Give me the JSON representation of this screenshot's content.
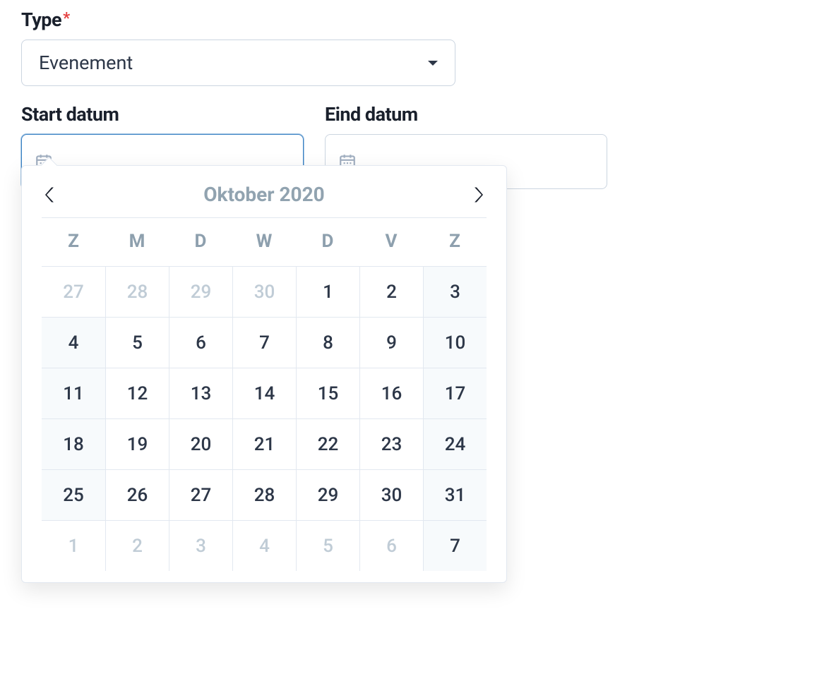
{
  "type_field": {
    "label": "Type",
    "required_mark": "*",
    "value": "Evenement"
  },
  "start_date": {
    "label": "Start datum",
    "value": ""
  },
  "end_date": {
    "label": "Eind datum",
    "value": ""
  },
  "datepicker": {
    "title": "Oktober 2020",
    "dow": [
      "Z",
      "M",
      "D",
      "W",
      "D",
      "V",
      "Z"
    ],
    "weeks": [
      [
        {
          "n": "27",
          "muted": true,
          "weekend": true
        },
        {
          "n": "28",
          "muted": true,
          "weekend": false
        },
        {
          "n": "29",
          "muted": true,
          "weekend": false
        },
        {
          "n": "30",
          "muted": true,
          "weekend": false
        },
        {
          "n": "1",
          "muted": false,
          "weekend": false
        },
        {
          "n": "2",
          "muted": false,
          "weekend": false
        },
        {
          "n": "3",
          "muted": false,
          "weekend": true
        }
      ],
      [
        {
          "n": "4",
          "muted": false,
          "weekend": true
        },
        {
          "n": "5",
          "muted": false,
          "weekend": false
        },
        {
          "n": "6",
          "muted": false,
          "weekend": false
        },
        {
          "n": "7",
          "muted": false,
          "weekend": false
        },
        {
          "n": "8",
          "muted": false,
          "weekend": false
        },
        {
          "n": "9",
          "muted": false,
          "weekend": false
        },
        {
          "n": "10",
          "muted": false,
          "weekend": true
        }
      ],
      [
        {
          "n": "11",
          "muted": false,
          "weekend": true
        },
        {
          "n": "12",
          "muted": false,
          "weekend": false
        },
        {
          "n": "13",
          "muted": false,
          "weekend": false
        },
        {
          "n": "14",
          "muted": false,
          "weekend": false
        },
        {
          "n": "15",
          "muted": false,
          "weekend": false
        },
        {
          "n": "16",
          "muted": false,
          "weekend": false
        },
        {
          "n": "17",
          "muted": false,
          "weekend": true
        }
      ],
      [
        {
          "n": "18",
          "muted": false,
          "weekend": true
        },
        {
          "n": "19",
          "muted": false,
          "weekend": false
        },
        {
          "n": "20",
          "muted": false,
          "weekend": false
        },
        {
          "n": "21",
          "muted": false,
          "weekend": false
        },
        {
          "n": "22",
          "muted": false,
          "weekend": false
        },
        {
          "n": "23",
          "muted": false,
          "weekend": false
        },
        {
          "n": "24",
          "muted": false,
          "weekend": true
        }
      ],
      [
        {
          "n": "25",
          "muted": false,
          "weekend": true
        },
        {
          "n": "26",
          "muted": false,
          "weekend": false
        },
        {
          "n": "27",
          "muted": false,
          "weekend": false
        },
        {
          "n": "28",
          "muted": false,
          "weekend": false
        },
        {
          "n": "29",
          "muted": false,
          "weekend": false
        },
        {
          "n": "30",
          "muted": false,
          "weekend": false
        },
        {
          "n": "31",
          "muted": false,
          "weekend": true
        }
      ],
      [
        {
          "n": "1",
          "muted": true,
          "weekend": true
        },
        {
          "n": "2",
          "muted": true,
          "weekend": false
        },
        {
          "n": "3",
          "muted": true,
          "weekend": false
        },
        {
          "n": "4",
          "muted": true,
          "weekend": false
        },
        {
          "n": "5",
          "muted": true,
          "weekend": false
        },
        {
          "n": "6",
          "muted": true,
          "weekend": false
        },
        {
          "n": "7",
          "muted": false,
          "weekend": true
        }
      ]
    ]
  }
}
